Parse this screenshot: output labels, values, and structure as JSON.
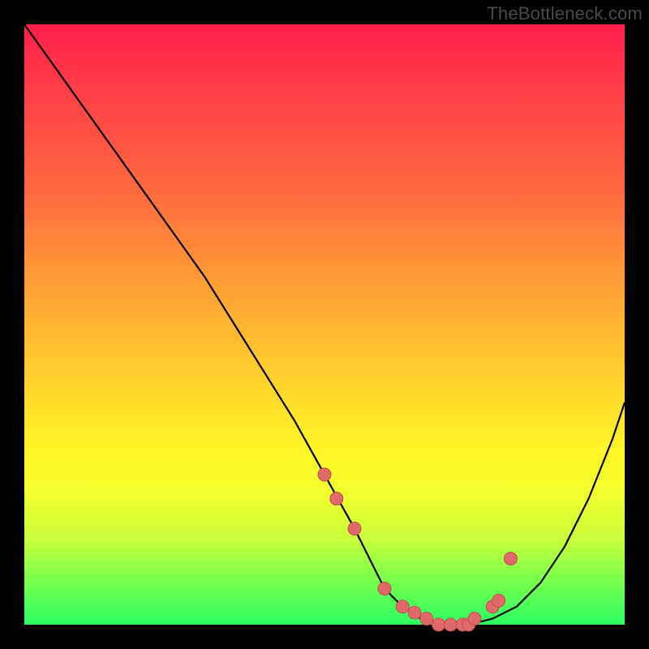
{
  "watermark": "TheBottleneck.com",
  "chart_data": {
    "type": "line",
    "title": "",
    "xlabel": "",
    "ylabel": "",
    "ylim": [
      0,
      100
    ],
    "xlim": [
      0,
      100
    ],
    "series": [
      {
        "name": "curve",
        "x": [
          0,
          5,
          10,
          15,
          20,
          25,
          30,
          35,
          40,
          45,
          50,
          55,
          58,
          60,
          63,
          66,
          70,
          74,
          78,
          82,
          86,
          90,
          94,
          98,
          100
        ],
        "values": [
          100,
          93,
          86,
          79,
          72,
          65,
          58,
          50,
          42,
          34,
          25,
          16,
          10,
          6,
          3,
          1,
          0,
          0,
          1,
          3,
          7,
          13,
          21,
          31,
          37
        ]
      },
      {
        "name": "scatter",
        "x": [
          50,
          52,
          55,
          60,
          63,
          65,
          67,
          69,
          71,
          73,
          74,
          75,
          78,
          79,
          81
        ],
        "values": [
          25,
          21,
          16,
          6,
          3,
          2,
          1,
          0,
          0,
          0,
          0,
          1,
          3,
          4,
          11
        ]
      }
    ],
    "annotations": []
  },
  "colors": {
    "curve": "#000000",
    "points_fill": "#e06a6a",
    "points_stroke": "#c24f4f"
  }
}
